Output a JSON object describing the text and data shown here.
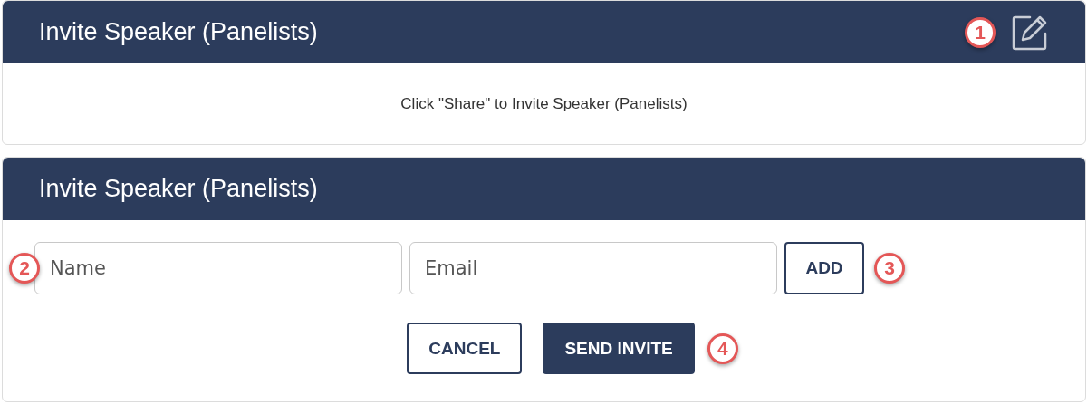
{
  "panels": [
    {
      "kind": "notice",
      "title": "Invite Speaker (Panelists)",
      "callout": "1",
      "message": "Click \"Share\" to Invite Speaker (Panelists)"
    },
    {
      "kind": "form",
      "title": "Invite Speaker (Panelists)",
      "fields": [
        {
          "placeholder": "Name",
          "callout": "2"
        },
        {
          "placeholder": "Email"
        }
      ],
      "add_button": {
        "label": "ADD",
        "callout": "3"
      },
      "actions": [
        {
          "label": "CANCEL",
          "kind": "secondary"
        },
        {
          "label": "SEND INVITE",
          "kind": "primary",
          "callout": "4"
        }
      ]
    }
  ]
}
